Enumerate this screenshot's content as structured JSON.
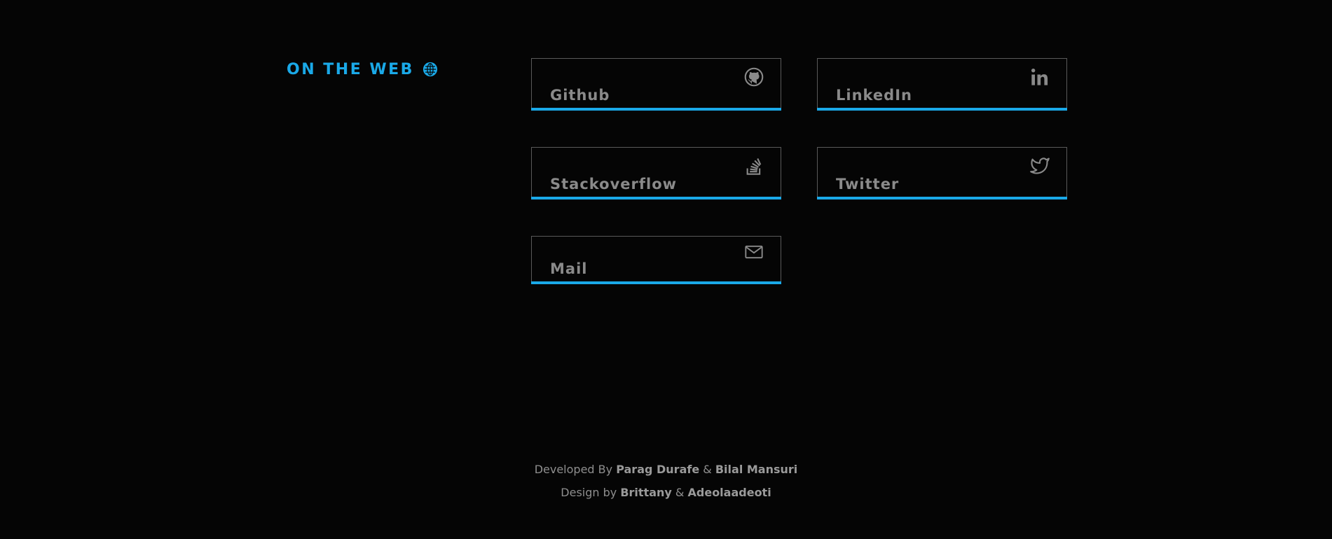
{
  "section": {
    "title": "ON THE WEB",
    "icon": "globe-icon",
    "accent_color": "#1aa9e8"
  },
  "links": [
    {
      "label": "Github",
      "icon": "github-icon"
    },
    {
      "label": "LinkedIn",
      "icon": "linkedin-icon"
    },
    {
      "label": "Stackoverflow",
      "icon": "stackoverflow-icon"
    },
    {
      "label": "Twitter",
      "icon": "twitter-icon"
    },
    {
      "label": "Mail",
      "icon": "mail-icon"
    }
  ],
  "footer": {
    "developed_prefix": "Developed By",
    "developer_1": "Parag Durafe",
    "developed_sep": "&",
    "developer_2": "Bilal Mansuri",
    "design_prefix": "Design by",
    "designer_1": "Brittany",
    "design_sep": "&",
    "designer_2": "Adeolaadeoti"
  }
}
